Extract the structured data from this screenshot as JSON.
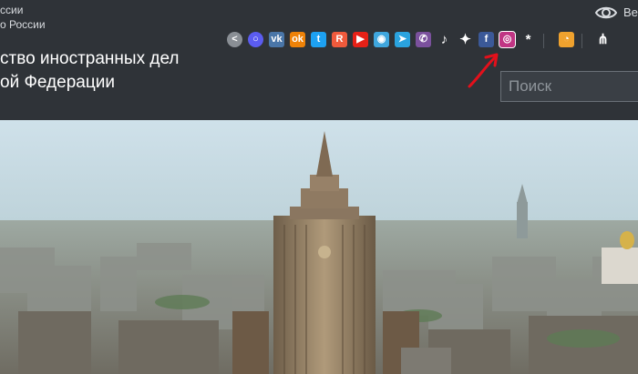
{
  "header": {
    "subtitle_line1": "ссии",
    "subtitle_line2": "о России",
    "title_line1": "ство иностранных дел",
    "title_line2": "ой Федерации",
    "version_label": "Ве"
  },
  "social": [
    {
      "name": "share-icon",
      "glyph": "<",
      "color": "#8a8f95"
    },
    {
      "name": "messenger-icon",
      "glyph": "○",
      "color": "#5b5cf0"
    },
    {
      "name": "vk-icon",
      "glyph": "vk",
      "color": "#4a76a8"
    },
    {
      "name": "odnoklassniki-icon",
      "glyph": "ok",
      "color": "#ee8208"
    },
    {
      "name": "twitter-icon",
      "glyph": "t",
      "color": "#1da1f2"
    },
    {
      "name": "rutube-icon",
      "glyph": "R",
      "color": "#ef5a3c"
    },
    {
      "name": "youtube-icon",
      "glyph": "▶",
      "color": "#e62117"
    },
    {
      "name": "location-icon",
      "glyph": "◉",
      "color": "#3fa6dd"
    },
    {
      "name": "telegram-icon",
      "glyph": "➤",
      "color": "#2aa3df"
    },
    {
      "name": "viber-icon",
      "glyph": "✆",
      "color": "#7b519d"
    },
    {
      "name": "tiktok-icon",
      "glyph": "♪",
      "color": "transparent"
    },
    {
      "name": "sparkle-icon",
      "glyph": "✦",
      "color": "transparent"
    },
    {
      "name": "facebook-icon",
      "glyph": "f",
      "color": "#3b5998"
    },
    {
      "name": "instagram-icon",
      "glyph": "◎",
      "color": "#c13584"
    },
    {
      "name": "asterisk-icon",
      "glyph": "*",
      "color": "transparent"
    },
    {
      "name": "rss-icon",
      "glyph": "◔",
      "color": "#f0a22e"
    },
    {
      "name": "sitemap-icon",
      "glyph": "⋔",
      "color": "transparent"
    }
  ],
  "search": {
    "placeholder": "Поиск"
  },
  "colors": {
    "header_bg": "#2f3338",
    "annotation_arrow": "#e3101b"
  }
}
